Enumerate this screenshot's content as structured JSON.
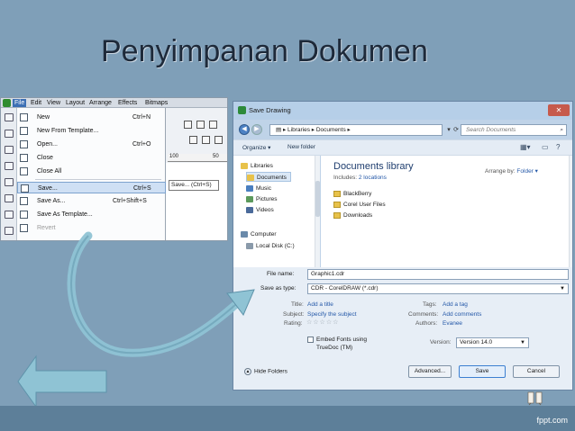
{
  "slide": {
    "title": "Penyimpanan Dokumen",
    "watermark": "fppt.com",
    "colors": {
      "background": "#7f9fb8",
      "accent": "#3c6fb4"
    }
  },
  "corel": {
    "menubar": [
      "File",
      "Edit",
      "View",
      "Layout",
      "Arrange",
      "Effects",
      "Bitmaps"
    ],
    "active_menu": "File",
    "file_menu": [
      {
        "label": "New",
        "shortcut": "Ctrl+N",
        "icon": "new-document-icon"
      },
      {
        "label": "New From Template...",
        "shortcut": "",
        "icon": "template-icon"
      },
      {
        "label": "Open...",
        "shortcut": "Ctrl+O",
        "icon": "open-folder-icon"
      },
      {
        "label": "Close",
        "shortcut": "",
        "icon": "close-document-icon"
      },
      {
        "label": "Close All",
        "shortcut": "",
        "icon": "close-all-icon"
      },
      {
        "label": "Save...",
        "shortcut": "Ctrl+S",
        "icon": "save-icon",
        "highlighted": true
      },
      {
        "label": "Save As...",
        "shortcut": "Ctrl+Shift+S",
        "icon": "save-as-icon"
      },
      {
        "label": "Save As Template...",
        "shortcut": "",
        "icon": "save-template-icon"
      },
      {
        "label": "Revert",
        "shortcut": "",
        "icon": "revert-icon",
        "disabled": true
      }
    ],
    "tooltip": "Save... (Ctrl+S)",
    "ruler": [
      "100",
      "50"
    ]
  },
  "dialog": {
    "title": "Save Drawing",
    "close_label": "✕",
    "address": "▸ Libraries ▸ Documents ▸",
    "search_placeholder": "Search Documents",
    "toolbar": {
      "organize": "Organize ▾",
      "new_folder": "New folder"
    },
    "nav_items": [
      {
        "label": "Libraries",
        "icon": "libraries-icon",
        "color": "#e8c24a"
      },
      {
        "label": "Documents",
        "icon": "documents-icon",
        "color": "#e8c24a",
        "selected": true
      },
      {
        "label": "Music",
        "icon": "music-icon",
        "color": "#4a7fc0"
      },
      {
        "label": "Pictures",
        "icon": "pictures-icon",
        "color": "#5c9a5c"
      },
      {
        "label": "Videos",
        "icon": "videos-icon",
        "color": "#4a6a9a"
      },
      {
        "label": "Computer",
        "icon": "computer-icon",
        "color": "#6a8aaa"
      },
      {
        "label": "Local Disk (C:)",
        "icon": "local-disk-icon",
        "color": "#8a9aaa"
      }
    ],
    "library": {
      "title": "Documents library",
      "includes_prefix": "Includes:",
      "includes_link": "2 locations",
      "arrange_prefix": "Arrange by:",
      "arrange_value": "Folder ▾",
      "folders": [
        "BlackBerry",
        "Corel User Files",
        "Downloads"
      ]
    },
    "form": {
      "file_name_label": "File name:",
      "file_name_value": "Graphic1.cdr",
      "save_type_label": "Save as type:",
      "save_type_value": "CDR - CorelDRAW (*.cdr)",
      "title_label": "Title:",
      "title_value": "Add a title",
      "subject_label": "Subject:",
      "subject_value": "Specify the subject",
      "rating_label": "Rating:",
      "rating_stars": "☆☆☆☆☆",
      "tags_label": "Tags:",
      "tags_value": "Add a tag",
      "comments_label": "Comments:",
      "comments_value": "Add comments",
      "authors_label": "Authors:",
      "authors_value": "Evanee",
      "embed_label_1": "Embed Fonts using",
      "embed_label_2": "TrueDoc (TM)",
      "version_label": "Version:",
      "version_value": "Version 14.0"
    },
    "buttons": {
      "hide_folders": "Hide Folders",
      "advanced": "Advanced...",
      "save": "Save",
      "cancel": "Cancel"
    }
  }
}
